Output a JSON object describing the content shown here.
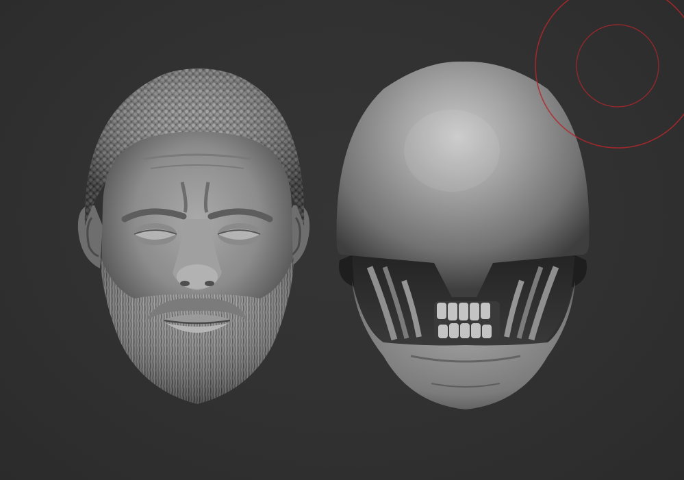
{
  "scene": {
    "background_color": "#313131",
    "models": [
      {
        "name": "human-head-sculpt",
        "kind": "bearded male head bust"
      },
      {
        "name": "alien-head-sculpt",
        "kind": "xenomorph-style dome head with exposed jaw"
      }
    ],
    "brush_cursor": {
      "color": "#b3272c",
      "shape": "double-ring"
    }
  }
}
